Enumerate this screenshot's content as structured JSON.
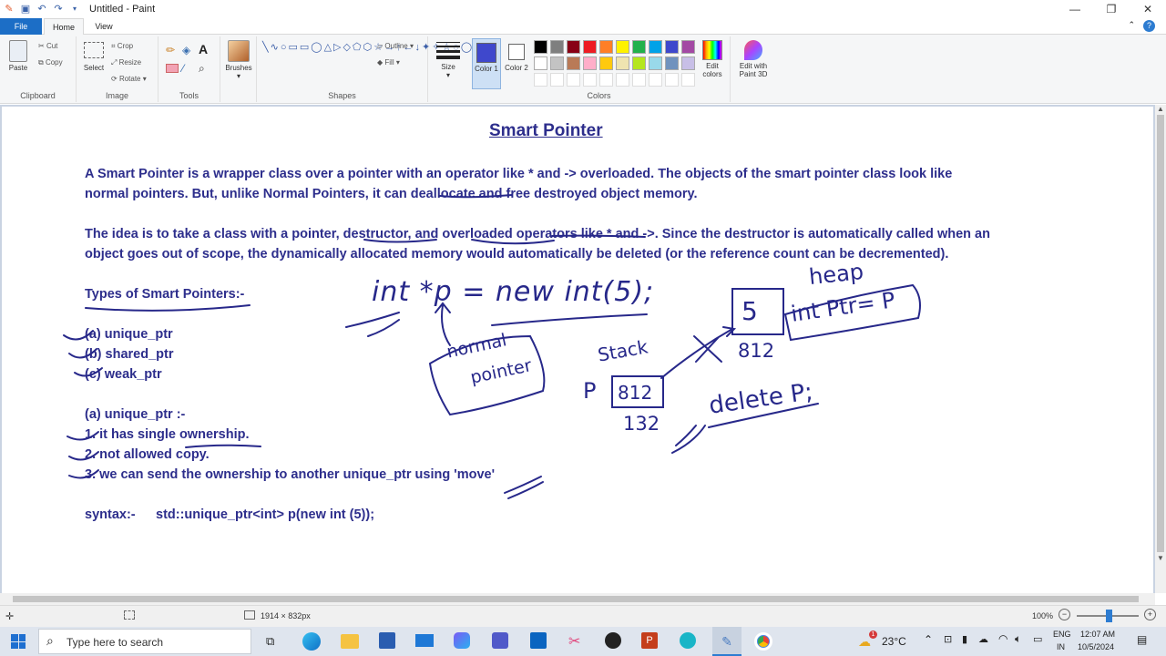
{
  "window": {
    "title": "Untitled - Paint"
  },
  "tabs": {
    "file": "File",
    "home": "Home",
    "view": "View"
  },
  "ribbon": {
    "paste": "Paste",
    "cut": "Cut",
    "copy": "Copy",
    "clipboard": "Clipboard",
    "select": "Select",
    "crop": "Crop",
    "resize": "Resize",
    "rotate": "Rotate",
    "image": "Image",
    "tools": "Tools",
    "brushes": "Brushes",
    "outline": "Outline",
    "fill": "Fill",
    "shapes": "Shapes",
    "size": "Size",
    "color1": "Color 1",
    "color2": "Color 2",
    "colors": "Colors",
    "edit_colors": "Edit colors",
    "edit_paint3d": "Edit with Paint 3D",
    "palette_row1": [
      "#000000",
      "#7f7f7f",
      "#880015",
      "#ed1c24",
      "#ff7f27",
      "#fff200",
      "#22b14c",
      "#00a2e8",
      "#3f48cc",
      "#a349a4"
    ],
    "palette_row2": [
      "#ffffff",
      "#c3c3c3",
      "#b97a57",
      "#ffaec9",
      "#ffc90e",
      "#efe4b0",
      "#b5e61d",
      "#99d9ea",
      "#7092be",
      "#c8bfe7"
    ],
    "color1_value": "#3f48cc"
  },
  "doc": {
    "title": "Smart Pointer",
    "para1_line1": "A Smart Pointer is a wrapper class over a pointer with an operator like * and -> overloaded. The objects of the smart pointer class look like",
    "para1_line2": "normal pointers. But, unlike Normal Pointers, it can deallocate and free destroyed object memory.",
    "para2_line1": "The idea is to take a class with a pointer, destructor, and overloaded operators like * and ->. Since the destructor is automatically called when an",
    "para2_line2": "object goes out of scope, the dynamically allocated memory would automatically be deleted (or the reference count can be decremented).",
    "types_heading": "Types of Smart Pointers:-",
    "types": [
      "(a) unique_ptr",
      "(b) shared_ptr",
      "(c) weak_ptr"
    ],
    "unique_heading": "(a) unique_ptr :-",
    "unique_points": [
      "1. it has single ownership.",
      "2. not allowed copy.",
      "3. we can send the ownership to another unique_ptr using 'move'"
    ],
    "syntax_label": "syntax:-",
    "syntax_code": "std::unique_ptr<int> p(new int (5));"
  },
  "handwriting": {
    "code": "int *p = new int(5);",
    "normal_pointer": [
      "normal",
      "pointer"
    ],
    "heap": "heap",
    "box_value": "5",
    "addr_812": "812",
    "stack": "Stack",
    "p_label": "P",
    "p_box": "812",
    "addr_132": "132",
    "int_ptr": "int Ptr= P",
    "delete": "delete P;"
  },
  "status": {
    "dimensions": "1914 × 832px",
    "zoom": "100%"
  },
  "taskbar": {
    "search": "Type here to search",
    "temp": "23°C",
    "lang1": "ENG",
    "lang2": "IN",
    "time": "12:07 AM",
    "date": "10/5/2024",
    "badge": "1"
  }
}
